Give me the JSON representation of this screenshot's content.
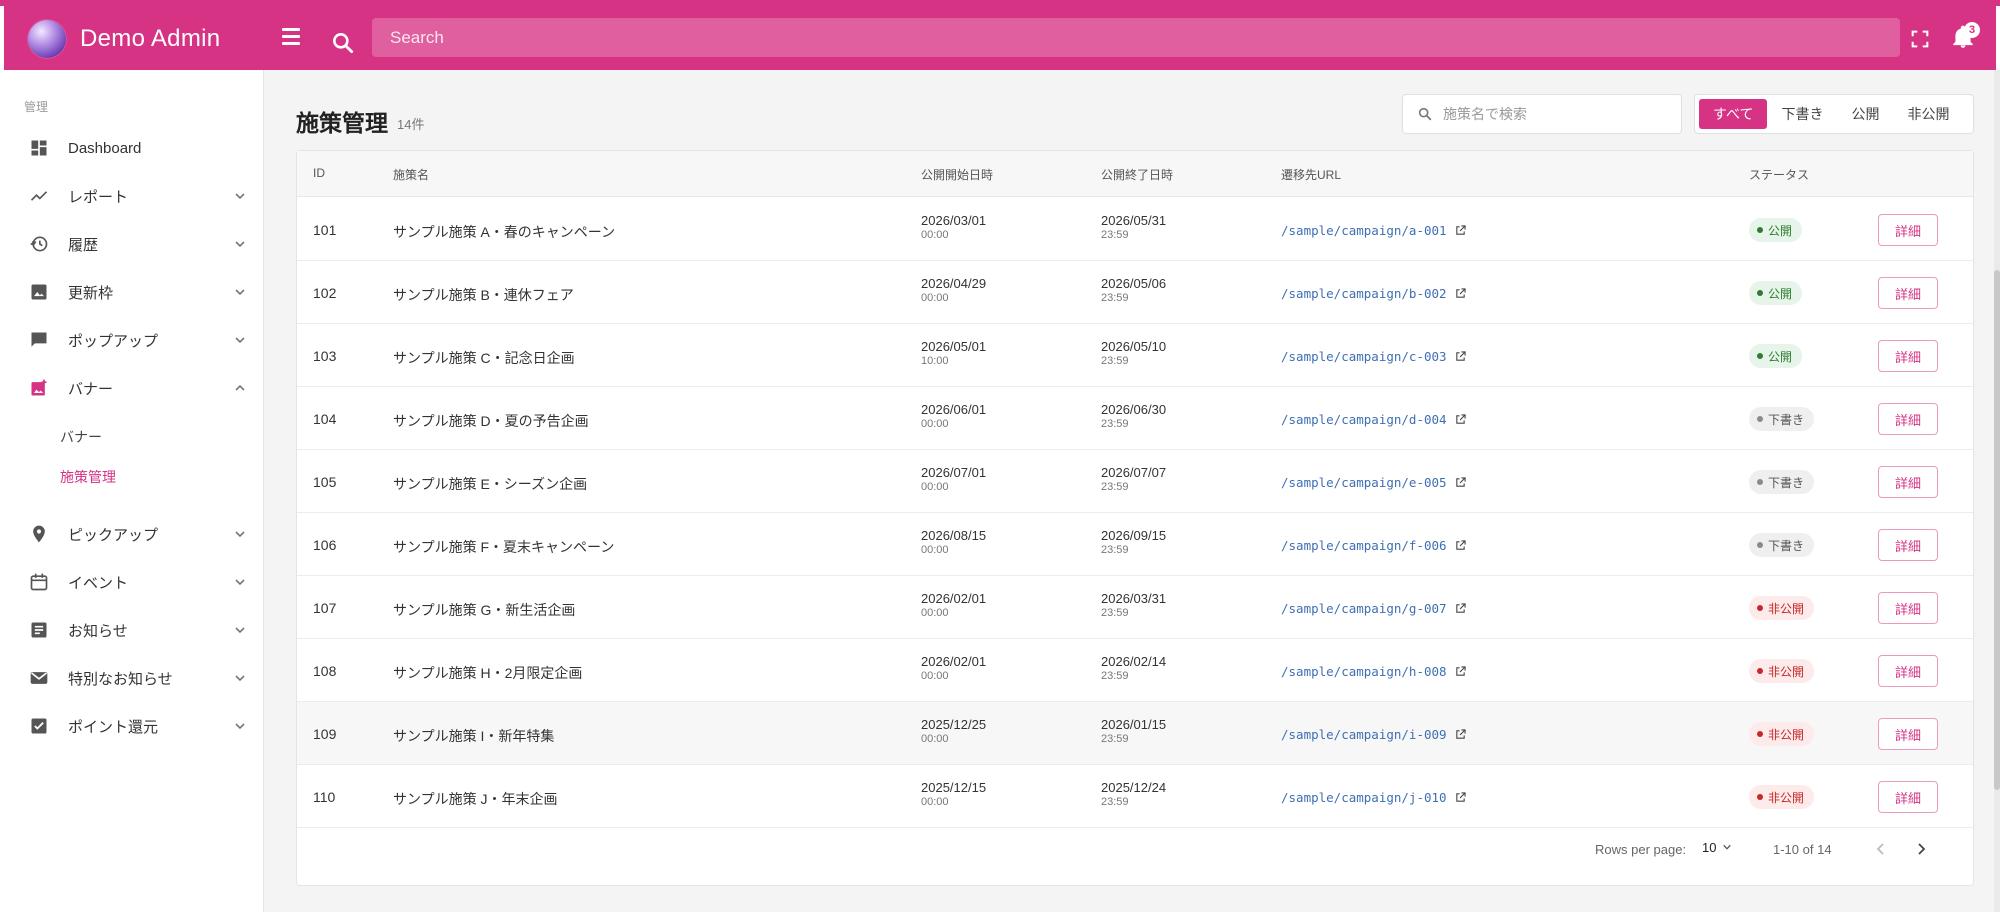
{
  "app": {
    "title": "Demo Admin",
    "search_placeholder": "Search",
    "notification_count": "3"
  },
  "sidebar": {
    "heading": "管理",
    "items": [
      {
        "label": "Dashboard",
        "icon": "dashboard-icon"
      },
      {
        "label": "レポート",
        "icon": "trending-icon"
      },
      {
        "label": "履歴",
        "icon": "history-icon"
      },
      {
        "label": "更新枠",
        "icon": "image-icon"
      },
      {
        "label": "ポップアップ",
        "icon": "chat-icon"
      },
      {
        "label": "バナー",
        "icon": "banner-icon",
        "expanded": true
      },
      {
        "label": "ピックアップ",
        "icon": "pin-icon"
      },
      {
        "label": "イベント",
        "icon": "calendar-icon"
      },
      {
        "label": "お知らせ",
        "icon": "article-icon"
      },
      {
        "label": "特別なお知らせ",
        "icon": "mail-icon"
      },
      {
        "label": "ポイント還元",
        "icon": "checkbox-icon"
      }
    ],
    "sub_items": [
      {
        "label": "バナー",
        "active": false
      },
      {
        "label": "施策管理",
        "active": true
      }
    ]
  },
  "page": {
    "title": "施策管理",
    "count": "14件",
    "search_placeholder": "施策名で検索",
    "filters": [
      "すべて",
      "下書き",
      "公開",
      "非公開"
    ],
    "active_filter": "すべて"
  },
  "table": {
    "columns": [
      "ID",
      "施策名",
      "公開開始日時",
      "公開終了日時",
      "遷移先URL",
      "ステータス"
    ],
    "detail_label": "詳細",
    "rows": [
      {
        "id": "101",
        "name": "サンプル施策 A・春のキャンペーン",
        "start_date": "2026/03/01",
        "start_time": "00:00",
        "end_date": "2026/05/31",
        "end_time": "23:59",
        "url": "/sample/campaign/a-001",
        "status": "公開",
        "status_kind": "pub"
      },
      {
        "id": "102",
        "name": "サンプル施策 B・連休フェア",
        "start_date": "2026/04/29",
        "start_time": "00:00",
        "end_date": "2026/05/06",
        "end_time": "23:59",
        "url": "/sample/campaign/b-002",
        "status": "公開",
        "status_kind": "pub"
      },
      {
        "id": "103",
        "name": "サンプル施策 C・記念日企画",
        "start_date": "2026/05/01",
        "start_time": "10:00",
        "end_date": "2026/05/10",
        "end_time": "23:59",
        "url": "/sample/campaign/c-003",
        "status": "公開",
        "status_kind": "pub"
      },
      {
        "id": "104",
        "name": "サンプル施策 D・夏の予告企画",
        "start_date": "2026/06/01",
        "start_time": "00:00",
        "end_date": "2026/06/30",
        "end_time": "23:59",
        "url": "/sample/campaign/d-004",
        "status": "下書き",
        "status_kind": "draft"
      },
      {
        "id": "105",
        "name": "サンプル施策 E・シーズン企画",
        "start_date": "2026/07/01",
        "start_time": "00:00",
        "end_date": "2026/07/07",
        "end_time": "23:59",
        "url": "/sample/campaign/e-005",
        "status": "下書き",
        "status_kind": "draft"
      },
      {
        "id": "106",
        "name": "サンプル施策 F・夏末キャンペーン",
        "start_date": "2026/08/15",
        "start_time": "00:00",
        "end_date": "2026/09/15",
        "end_time": "23:59",
        "url": "/sample/campaign/f-006",
        "status": "下書き",
        "status_kind": "draft"
      },
      {
        "id": "107",
        "name": "サンプル施策 G・新生活企画",
        "start_date": "2026/02/01",
        "start_time": "00:00",
        "end_date": "2026/03/31",
        "end_time": "23:59",
        "url": "/sample/campaign/g-007",
        "status": "非公開",
        "status_kind": "priv"
      },
      {
        "id": "108",
        "name": "サンプル施策 H・2月限定企画",
        "start_date": "2026/02/01",
        "start_time": "00:00",
        "end_date": "2026/02/14",
        "end_time": "23:59",
        "url": "/sample/campaign/h-008",
        "status": "非公開",
        "status_kind": "priv"
      },
      {
        "id": "109",
        "name": "サンプル施策 I・新年特集",
        "start_date": "2025/12/25",
        "start_time": "00:00",
        "end_date": "2026/01/15",
        "end_time": "23:59",
        "url": "/sample/campaign/i-009",
        "status": "非公開",
        "status_kind": "priv"
      },
      {
        "id": "110",
        "name": "サンプル施策 J・年末企画",
        "start_date": "2025/12/15",
        "start_time": "00:00",
        "end_date": "2025/12/24",
        "end_time": "23:59",
        "url": "/sample/campaign/j-010",
        "status": "非公開",
        "status_kind": "priv"
      }
    ]
  },
  "pagination": {
    "rows_per_page_label": "Rows per page:",
    "rows_per_page": "10",
    "range": "1-10 of 14"
  },
  "colors": {
    "accent": "#d63384",
    "published": "#2e7d32",
    "draft": "#8a8a8a",
    "private": "#c62828",
    "link": "#3f6fb3"
  }
}
